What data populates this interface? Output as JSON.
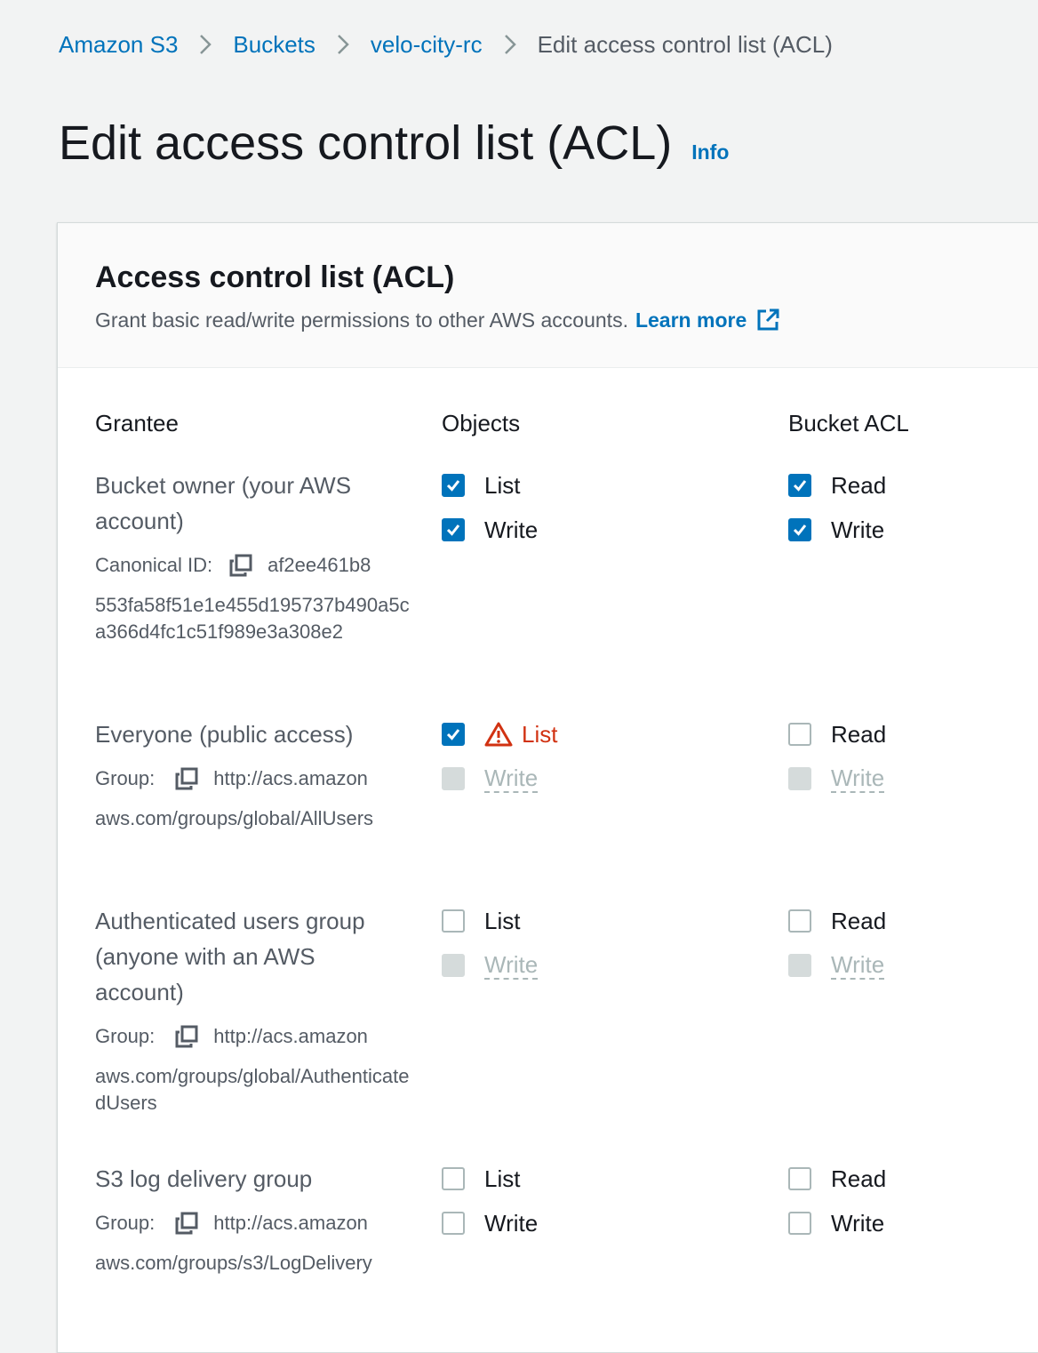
{
  "breadcrumb": {
    "items": [
      "Amazon S3",
      "Buckets",
      "velo-city-rc"
    ],
    "current": "Edit access control list (ACL)"
  },
  "page": {
    "title": "Edit access control list (ACL)",
    "info": "Info"
  },
  "panel": {
    "title": "Access control list (ACL)",
    "description": "Grant basic read/write permissions to other AWS accounts.",
    "learn_more": "Learn more"
  },
  "columns": {
    "grantee": "Grantee",
    "objects": "Objects",
    "bucket_acl": "Bucket ACL"
  },
  "grantees": [
    {
      "name": "Bucket owner (your AWS account)",
      "id_label": "Canonical ID:",
      "id_first": "af2ee461b8",
      "id_rest": "553fa58f51e1e455d195737b490a5ca366d4fc1c51f989e3a308e2",
      "objects": [
        {
          "label": "List",
          "state": "checked"
        },
        {
          "label": "Write",
          "state": "checked"
        }
      ],
      "bucket_acl": [
        {
          "label": "Read",
          "state": "checked"
        },
        {
          "label": "Write",
          "state": "checked"
        }
      ]
    },
    {
      "name": "Everyone (public access)",
      "id_label": "Group:",
      "id_first": "http://acs.amazon",
      "id_rest": "aws.com/groups/global/AllUsers",
      "objects": [
        {
          "label": "List",
          "state": "checked",
          "warning": true
        },
        {
          "label": "Write",
          "state": "disabled"
        }
      ],
      "bucket_acl": [
        {
          "label": "Read",
          "state": "unchecked"
        },
        {
          "label": "Write",
          "state": "disabled"
        }
      ]
    },
    {
      "name": "Authenticated users group (anyone with an AWS account)",
      "id_label": "Group:",
      "id_first": "http://acs.amazon",
      "id_rest": "aws.com/groups/global/AuthenticatedUsers",
      "objects": [
        {
          "label": "List",
          "state": "unchecked"
        },
        {
          "label": "Write",
          "state": "disabled"
        }
      ],
      "bucket_acl": [
        {
          "label": "Read",
          "state": "unchecked"
        },
        {
          "label": "Write",
          "state": "disabled"
        }
      ]
    },
    {
      "name": "S3 log delivery group",
      "id_label": "Group:",
      "id_first": "http://acs.amazon",
      "id_rest": "aws.com/groups/s3/LogDelivery",
      "objects": [
        {
          "label": "List",
          "state": "unchecked"
        },
        {
          "label": "Write",
          "state": "unchecked"
        }
      ],
      "bucket_acl": [
        {
          "label": "Read",
          "state": "unchecked"
        },
        {
          "label": "Write",
          "state": "unchecked"
        }
      ]
    }
  ],
  "colors": {
    "link": "#0073bb",
    "checked": "#0073bb",
    "warning": "#d13212",
    "disabled": "#aab7b8"
  },
  "icons": {
    "copy": "copy-icon",
    "external": "external-link-icon",
    "warning": "warning-icon",
    "chevron": "chevron-right-icon"
  }
}
